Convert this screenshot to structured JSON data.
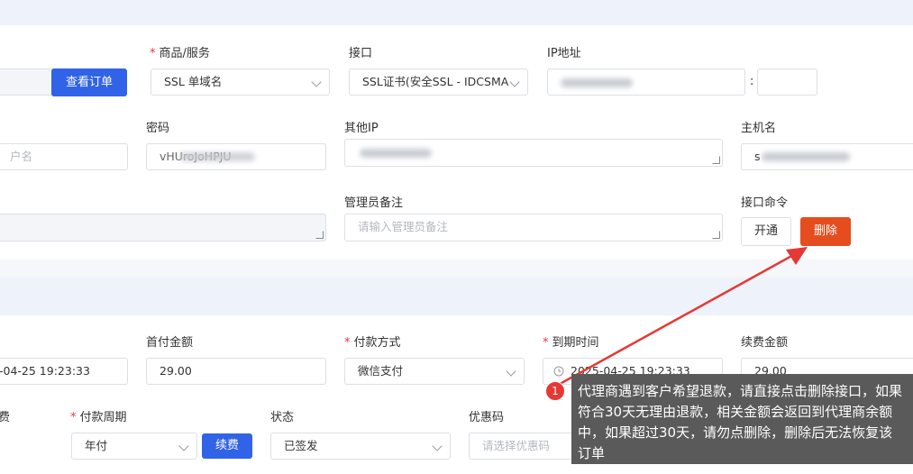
{
  "order_section": {
    "product_label": "商品/服务",
    "interface_label": "接口",
    "ip_label": "IP地址",
    "view_order_button": "查看订单",
    "product_value": "SSL 单域名",
    "interface_value": "SSL证书(安全SSL - IDCSMA",
    "ip_separator": ":",
    "password_label": "密码",
    "other_ip_label": "其他IP",
    "hostname_label": "主机名",
    "username_placeholder_fragment": "户名",
    "password_value": "vHUroJoHPJU",
    "hostname_value": "s",
    "admin_note_label": "管理员备注",
    "admin_note_placeholder": "请输入管理员备注",
    "interface_command_label": "接口命令",
    "activate_button": "开通",
    "delete_button": "删除"
  },
  "billing_section": {
    "first_payment_label": "首付金额",
    "payment_method_label": "付款方式",
    "due_date_label": "到期时间",
    "renewal_amount_label": "续费金额",
    "start_date_value": "-04-25 19:23:33",
    "first_payment_value": "29.00",
    "payment_method_value": "微信支付",
    "due_date_value": "2025-04-25 19:23:33",
    "renewal_amount_value": "29.00",
    "renew_fee_label_fragment": "费",
    "billing_cycle_label": "付款周期",
    "status_label": "状态",
    "coupon_label": "优惠码",
    "billing_cycle_value": "年付",
    "renew_button": "续费",
    "status_value": "已签发",
    "coupon_placeholder": "请选择优惠码"
  },
  "annotation": {
    "badge_number": "1",
    "text": "代理商遇到客户希望退款，请直接点击删除接口，如果符合30天无理由退款，相关金额会返回到代理商余额中，如果超过30天，请勿点删除，删除后无法恢复该订单"
  },
  "colors": {
    "primary": "#3163e8",
    "danger": "#e54d1f",
    "arrow": "#e53935",
    "tooltip_bg": "#5a5a5a"
  }
}
